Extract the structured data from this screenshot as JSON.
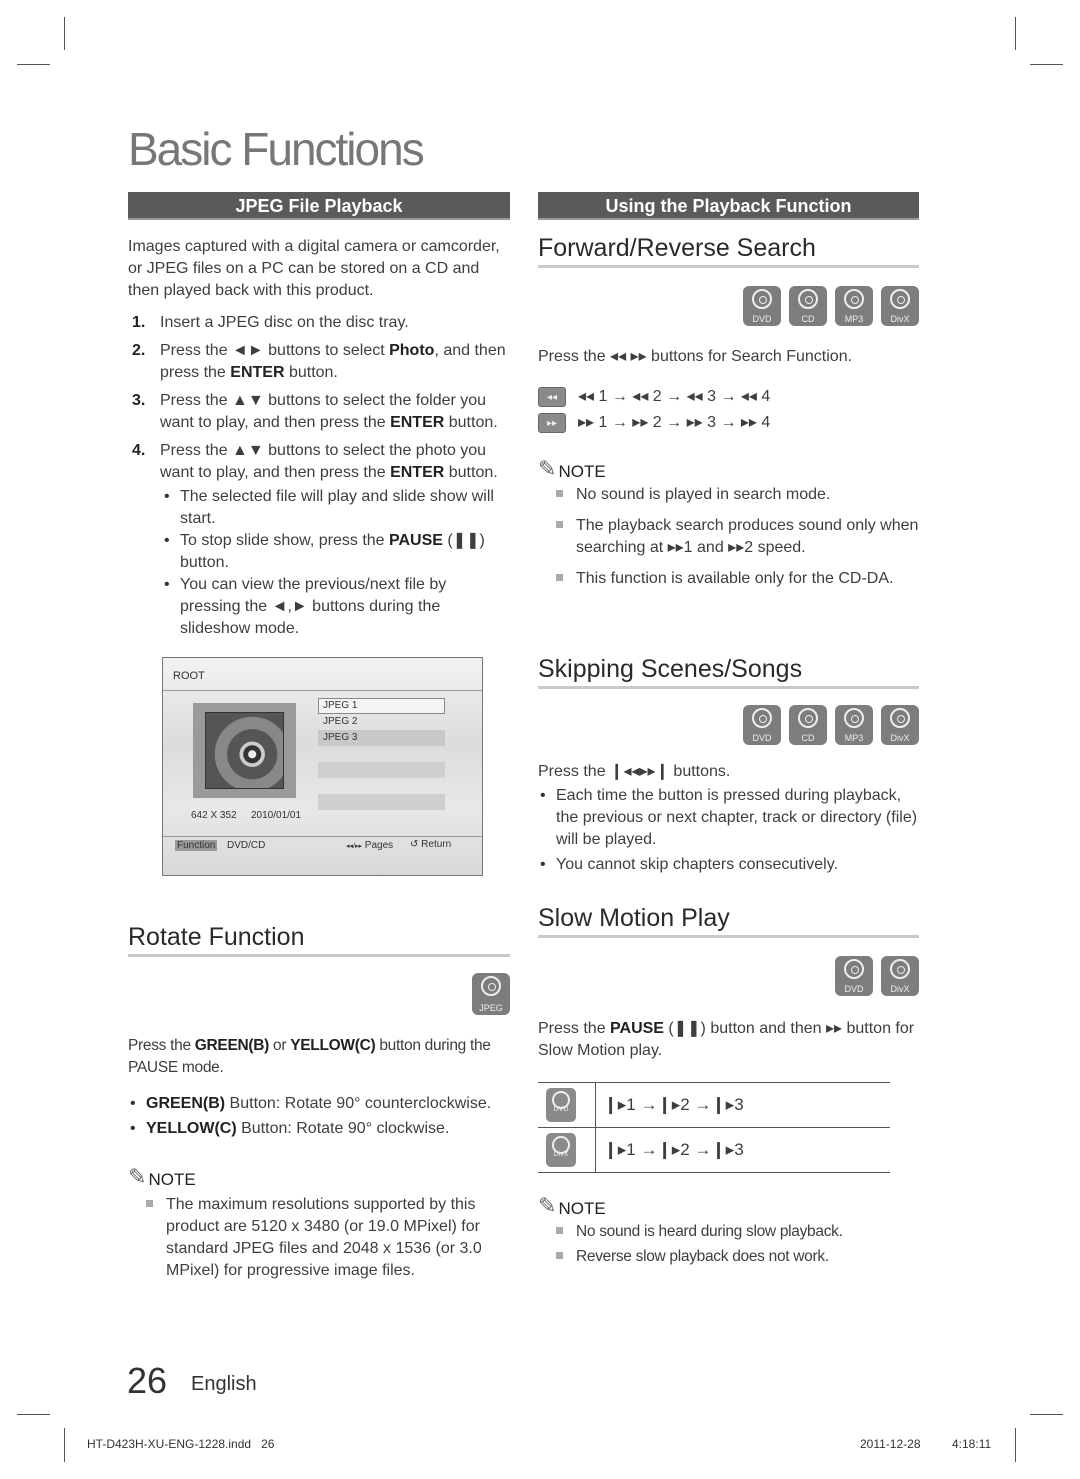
{
  "page_title": "Basic Functions",
  "left": {
    "section_bar": "JPEG File Playback",
    "intro": "Images captured with a digital camera or camcorder, or JPEG files on a PC can be stored on a CD and then played back with this product.",
    "steps": [
      {
        "num": "1.",
        "text": "Insert a JPEG disc on the disc tray."
      },
      {
        "num": "2.",
        "pre": "Press the ◄► buttons to select ",
        "b1": "Photo",
        "mid": ", and then press the ",
        "b2": "ENTER",
        "post": " button."
      },
      {
        "num": "3.",
        "pre": "Press the ▲▼ buttons to select the folder you want to play, and then press the ",
        "b2": "ENTER",
        "post": " button."
      },
      {
        "num": "4.",
        "pre": "Press the ▲▼ buttons to select the photo you want to play, and then press the ",
        "b2": "ENTER",
        "post": " button."
      }
    ],
    "bullets": [
      {
        "text": "The selected file will play and slide show will start."
      },
      {
        "pre": "To stop slide show, press the ",
        "b": "PAUSE",
        "post": " (❚❚) button."
      },
      {
        "text": "You can view the previous/next file by pressing the ◄,► buttons during the slideshow mode."
      }
    ],
    "screen": {
      "header": "ROOT",
      "files": [
        "JPEG 1",
        "JPEG 2",
        "JPEG 3"
      ],
      "resolution": "642 X 352",
      "date": "2010/01/01",
      "function_label": "Function",
      "source": "DVD/CD",
      "pages_icon": "◂◂/▸▸",
      "pages_label": "Pages",
      "return_icon": "↺",
      "return_label": "Return"
    },
    "rotate": {
      "heading": "Rotate Function",
      "disc": "JPEG",
      "pre": "Press the ",
      "b1": "GREEN(B)",
      "mid": " or ",
      "b2": "YELLOW(C)",
      "post": " button during the PAUSE mode.",
      "bullets": [
        {
          "b": "GREEN(B)",
          "text": " Button: Rotate 90° counterclockwise."
        },
        {
          "b": "YELLOW(C)",
          "text": " Button: Rotate 90° clockwise."
        }
      ],
      "note_label": "NOTE",
      "notes": [
        "The maximum resolutions supported by this product are 5120 x 3480 (or 19.0 MPixel) for standard JPEG files and 2048 x 1536 (or 3.0 MPixel) for progressive image files."
      ]
    }
  },
  "right": {
    "section_bar": "Using the Playback Function",
    "search": {
      "heading": "Forward/Reverse Search",
      "discs": [
        "DVD",
        "CD",
        "MP3",
        "DivX"
      ],
      "instruction": "Press the ◂◂ ▸▸ buttons for Search Function.",
      "rev_btn": "◂◂",
      "fwd_btn": "▸▸",
      "rev_seq": "◂◂ 1 → ◂◂ 2 → ◂◂ 3 → ◂◂ 4",
      "fwd_seq": "▸▸ 1 → ▸▸ 2 → ▸▸ 3 → ▸▸ 4",
      "note_label": "NOTE",
      "notes": [
        "No sound is played in search mode.",
        "The playback search produces sound only when searching at ▸▸1 and ▸▸2 speed.",
        "This function is available only for the CD-DA."
      ]
    },
    "skip": {
      "heading": "Skipping Scenes/Songs",
      "discs": [
        "DVD",
        "CD",
        "MP3",
        "DivX"
      ],
      "instruction": "Press the ❙◂◂▸▸❙ buttons.",
      "bullets": [
        "Each time the button is pressed during playback, the previous or next chapter, track or directory (file) will be played.",
        "You cannot skip chapters consecutively."
      ]
    },
    "slow": {
      "heading": "Slow Motion Play",
      "discs": [
        "DVD",
        "DivX"
      ],
      "pre": "Press the ",
      "b": "PAUSE",
      "post": " (❚❚) button and then ▸▸ button for Slow Motion play.",
      "table": [
        {
          "disc": "DVD",
          "seq": "❙▸1 →❙▸2 →❙▸3"
        },
        {
          "disc": "DivX",
          "seq": "❙▸1 →❙▸2 →❙▸3"
        }
      ],
      "note_label": "NOTE",
      "notes": [
        "No sound is heard during slow playback.",
        "Reverse slow playback does not work."
      ]
    }
  },
  "footer": {
    "page_number": "26",
    "language": "English",
    "file": "HT-D423H-XU-ENG-1228.indd   26",
    "date": "2011-12-28",
    "time": "4:18:11"
  }
}
